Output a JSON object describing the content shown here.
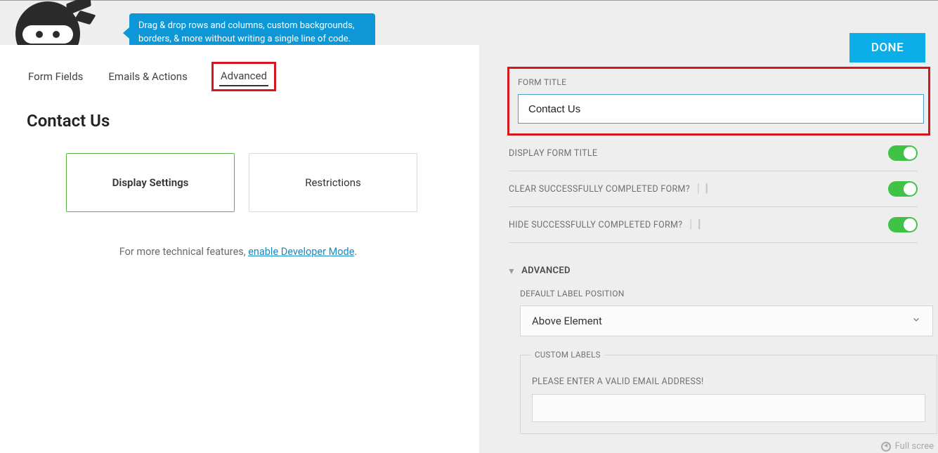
{
  "tooltip": {
    "text": "Drag & drop rows and columns, custom backgrounds, borders, & more without writing a single line of code."
  },
  "tabs": {
    "form_fields": "Form Fields",
    "emails_actions": "Emails & Actions",
    "advanced": "Advanced"
  },
  "form_name": "Contact Us",
  "cards": {
    "display_settings": "Display Settings",
    "restrictions": "Restrictions"
  },
  "dev_mode": {
    "prefix": "For more technical features, ",
    "link": "enable Developer Mode",
    "suffix": "."
  },
  "right": {
    "done": "DONE",
    "form_title_label": "FORM TITLE",
    "form_title_value": "Contact Us",
    "display_form_title": "DISPLAY FORM TITLE",
    "clear_completed": "CLEAR SUCCESSFULLY COMPLETED FORM?",
    "hide_completed": "HIDE SUCCESSFULLY COMPLETED FORM?",
    "advanced_section": "ADVANCED",
    "default_label_position": "DEFAULT LABEL POSITION",
    "default_label_value": "Above Element",
    "custom_labels_title": "CUSTOM LABELS",
    "custom_labels_sub": "PLEASE ENTER A VALID EMAIL ADDRESS!",
    "custom_labels_value": "",
    "fullscreen": "Full scree"
  }
}
